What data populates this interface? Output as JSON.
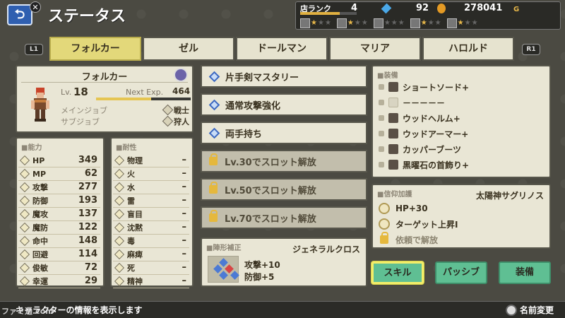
{
  "screen": {
    "title": "ステータス"
  },
  "resources": {
    "shop_rank_label": "店ランク",
    "shop_rank": "4",
    "gems": "92",
    "gold": "278041",
    "gold_unit": "G",
    "tools": [
      {
        "icon": "pickaxe-icon",
        "stars": 1
      },
      {
        "icon": "pot-icon",
        "stars": 1
      },
      {
        "icon": "saw-icon",
        "stars": 0
      },
      {
        "icon": "book-icon",
        "stars": 1
      },
      {
        "icon": "scroll-icon",
        "stars": 1
      }
    ]
  },
  "tabs": {
    "l1": "L1",
    "r1": "R1",
    "items": [
      "フォルカー",
      "ゼル",
      "ドールマン",
      "マリア",
      "ハロルド"
    ],
    "active": 0
  },
  "character": {
    "name": "フォルカー",
    "lv_label": "Lv.",
    "level": "18",
    "exp_label": "Next Exp.",
    "next_exp": "464",
    "exp_fraction": 0.58,
    "main_job_label": "メインジョブ",
    "main_job": "戦士",
    "sub_job_label": "サブジョブ",
    "sub_job": "狩人"
  },
  "ability": {
    "label": "■能力",
    "rows": [
      {
        "label": "HP",
        "value": "349"
      },
      {
        "label": "MP",
        "value": "62"
      },
      {
        "label": "攻撃",
        "value": "277"
      },
      {
        "label": "防御",
        "value": "193"
      },
      {
        "label": "魔攻",
        "value": "137"
      },
      {
        "label": "魔防",
        "value": "122"
      },
      {
        "label": "命中",
        "value": "148"
      },
      {
        "label": "回避",
        "value": "114"
      },
      {
        "label": "俊敏",
        "value": "72"
      },
      {
        "label": "幸運",
        "value": "29"
      }
    ]
  },
  "resistance": {
    "label": "■耐性",
    "rows": [
      {
        "label": "物理",
        "value": "–"
      },
      {
        "label": "火",
        "value": "–"
      },
      {
        "label": "水",
        "value": "–"
      },
      {
        "label": "雷",
        "value": "–"
      },
      {
        "label": "盲目",
        "value": "–"
      },
      {
        "label": "沈黙",
        "value": "–"
      },
      {
        "label": "毒",
        "value": "–"
      },
      {
        "label": "麻痺",
        "value": "–"
      },
      {
        "label": "死",
        "value": "–"
      },
      {
        "label": "精神",
        "value": "–"
      }
    ]
  },
  "skills": [
    {
      "label": "片手剣マスタリー",
      "locked": false
    },
    {
      "label": "通常攻撃強化",
      "locked": false
    },
    {
      "label": "両手持ち",
      "locked": false
    },
    {
      "label": "Lv.30でスロット解放",
      "locked": true
    },
    {
      "label": "Lv.50でスロット解放",
      "locked": true
    },
    {
      "label": "Lv.70でスロット解放",
      "locked": true
    }
  ],
  "formation": {
    "label": "■陣形補正",
    "name": "ジェネラルクロス",
    "bonus1": "攻撃+10",
    "bonus2": "防御+5"
  },
  "equipment": {
    "label": "■装備",
    "items": [
      {
        "name": "ショートソード+",
        "icon": "sword-icon"
      },
      {
        "name": "－－－－－",
        "icon": "empty-slot-icon"
      },
      {
        "name": "ウッドヘルム+",
        "icon": "helmet-icon"
      },
      {
        "name": "ウッドアーマー+",
        "icon": "armor-icon"
      },
      {
        "name": "カッパーブーツ",
        "icon": "boots-icon"
      },
      {
        "name": "黒曜石の首飾り+",
        "icon": "necklace-icon"
      }
    ]
  },
  "faith": {
    "label": "■信仰加護",
    "god": "太陽神サグリノス",
    "rows": [
      {
        "label": "HP+30",
        "locked": false
      },
      {
        "label": "ターゲット上昇Ⅰ",
        "locked": false
      },
      {
        "label": "依頼で解放",
        "locked": true
      }
    ]
  },
  "buttons": {
    "skill": "スキル",
    "passive": "パッシブ",
    "equip": "装備"
  },
  "footer": {
    "hint": "キャラクターの情報を表示します",
    "rename": "名前変更",
    "watermark": "ファミ通.com"
  },
  "colors": {
    "accent_tab": "#e3d87a",
    "button_green": "#5fbf93",
    "button_focus": "#f2ed6a",
    "skill_blue": "#3c68c0"
  }
}
